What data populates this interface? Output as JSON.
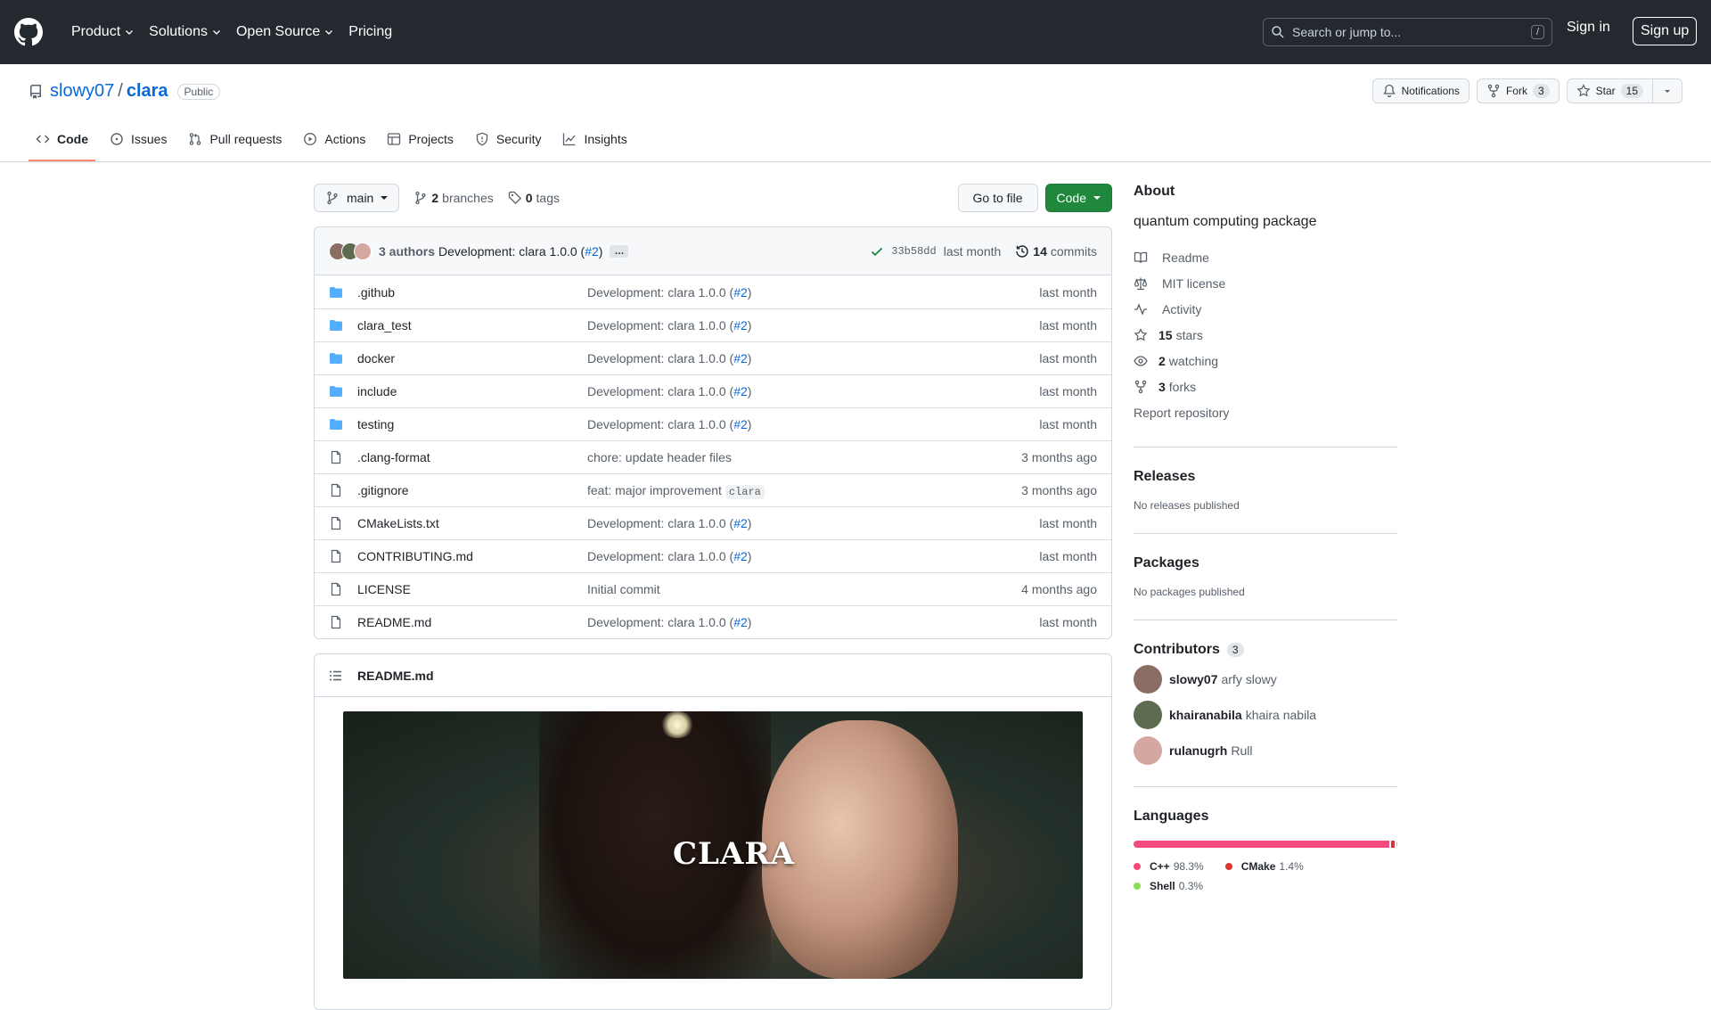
{
  "header": {
    "nav": [
      "Product",
      "Solutions",
      "Open Source",
      "Pricing"
    ],
    "search_placeholder": "Search or jump to...",
    "search_key": "/",
    "signin": "Sign in",
    "signup": "Sign up"
  },
  "repo": {
    "owner": "slowy07",
    "separator": "/",
    "name": "clara",
    "visibility": "Public",
    "notifications_label": "Notifications",
    "fork_label": "Fork",
    "fork_count": "3",
    "star_label": "Star",
    "star_count": "15"
  },
  "tabs": [
    {
      "label": "Code",
      "icon": "code-icon",
      "active": true
    },
    {
      "label": "Issues",
      "icon": "issue-icon",
      "active": false
    },
    {
      "label": "Pull requests",
      "icon": "pull-request-icon",
      "active": false
    },
    {
      "label": "Actions",
      "icon": "play-icon",
      "active": false
    },
    {
      "label": "Projects",
      "icon": "table-icon",
      "active": false
    },
    {
      "label": "Security",
      "icon": "shield-icon",
      "active": false
    },
    {
      "label": "Insights",
      "icon": "graph-icon",
      "active": false
    }
  ],
  "toolbar": {
    "branch": "main",
    "branches_count": "2",
    "branches_label": "branches",
    "tags_count": "0",
    "tags_label": "tags",
    "go_to_file": "Go to file",
    "code_button": "Code"
  },
  "commit": {
    "authors": "3 authors",
    "message": "Development: clara 1.0.0 (",
    "pr_link": "#2",
    "message_end": ")",
    "ellipsis": "…",
    "sha": "33b58dd",
    "time": "last month",
    "count": "14",
    "count_label": "commits"
  },
  "files": [
    {
      "type": "dir",
      "name": ".github",
      "msg": "Development: clara 1.0.0 (",
      "pr": "#2",
      "msg_end": ")",
      "code": "",
      "time": "last month"
    },
    {
      "type": "dir",
      "name": "clara_test",
      "msg": "Development: clara 1.0.0 (",
      "pr": "#2",
      "msg_end": ")",
      "code": "",
      "time": "last month"
    },
    {
      "type": "dir",
      "name": "docker",
      "msg": "Development: clara 1.0.0 (",
      "pr": "#2",
      "msg_end": ")",
      "code": "",
      "time": "last month"
    },
    {
      "type": "dir",
      "name": "include",
      "msg": "Development: clara 1.0.0 (",
      "pr": "#2",
      "msg_end": ")",
      "code": "",
      "time": "last month"
    },
    {
      "type": "dir",
      "name": "testing",
      "msg": "Development: clara 1.0.0 (",
      "pr": "#2",
      "msg_end": ")",
      "code": "",
      "time": "last month"
    },
    {
      "type": "file",
      "name": ".clang-format",
      "msg": "chore: update header files",
      "pr": "",
      "msg_end": "",
      "code": "",
      "time": "3 months ago"
    },
    {
      "type": "file",
      "name": ".gitignore",
      "msg": "feat: major improvement ",
      "pr": "",
      "msg_end": "",
      "code": "clara",
      "time": "3 months ago"
    },
    {
      "type": "file",
      "name": "CMakeLists.txt",
      "msg": "Development: clara 1.0.0 (",
      "pr": "#2",
      "msg_end": ")",
      "code": "",
      "time": "last month"
    },
    {
      "type": "file",
      "name": "CONTRIBUTING.md",
      "msg": "Development: clara 1.0.0 (",
      "pr": "#2",
      "msg_end": ")",
      "code": "",
      "time": "last month"
    },
    {
      "type": "file",
      "name": "LICENSE",
      "msg": "Initial commit",
      "pr": "",
      "msg_end": "",
      "code": "",
      "time": "4 months ago"
    },
    {
      "type": "file",
      "name": "README.md",
      "msg": "Development: clara 1.0.0 (",
      "pr": "#2",
      "msg_end": ")",
      "code": "",
      "time": "last month"
    }
  ],
  "readme": {
    "filename": "README.md",
    "banner_text": "CLARA"
  },
  "about": {
    "title": "About",
    "description": "quantum computing package",
    "items": [
      {
        "icon": "book-icon",
        "bold": "",
        "text": "Readme"
      },
      {
        "icon": "law-icon",
        "bold": "",
        "text": "MIT license"
      },
      {
        "icon": "pulse-icon",
        "bold": "",
        "text": "Activity"
      },
      {
        "icon": "star-icon",
        "bold": "15",
        "text": "stars"
      },
      {
        "icon": "eye-icon",
        "bold": "2",
        "text": "watching"
      },
      {
        "icon": "fork-icon",
        "bold": "3",
        "text": "forks"
      }
    ],
    "report": "Report repository"
  },
  "releases": {
    "title": "Releases",
    "empty": "No releases published"
  },
  "packages": {
    "title": "Packages",
    "empty": "No packages published"
  },
  "contributors": {
    "title": "Contributors",
    "count": "3",
    "list": [
      {
        "login": "slowy07",
        "name": "arfy slowy",
        "color": "#8a6d63"
      },
      {
        "login": "khairanabila",
        "name": "khaira nabila",
        "color": "#5d6b4f"
      },
      {
        "login": "rulanugrh",
        "name": "Rull",
        "color": "#d4a7a0"
      }
    ]
  },
  "languages": {
    "title": "Languages",
    "list": [
      {
        "name": "C++",
        "pct": "98.3%",
        "value": 98.3,
        "color": "#f34b7d"
      },
      {
        "name": "CMake",
        "pct": "1.4%",
        "value": 1.4,
        "color": "#DA3434"
      },
      {
        "name": "Shell",
        "pct": "0.3%",
        "value": 0.3,
        "color": "#89e051"
      }
    ]
  },
  "colors": {
    "header_bg": "#24292f",
    "link": "#0969da",
    "primary_button": "#1f883d",
    "active_tab_underline": "#fd8c73",
    "folder": "#54aeff"
  }
}
